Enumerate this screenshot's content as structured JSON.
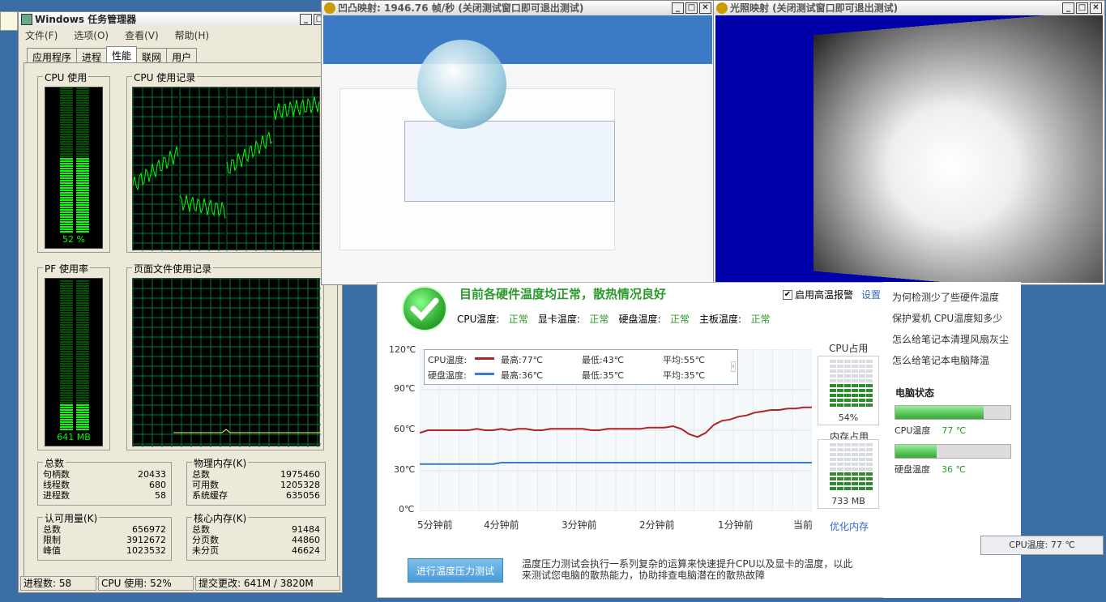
{
  "desktop": {
    "icon_label": ""
  },
  "task_manager": {
    "title": "Windows 任务管理器",
    "menu": [
      "文件(F)",
      "选项(O)",
      "查看(V)",
      "帮助(H)"
    ],
    "tabs": [
      "应用程序",
      "进程",
      "性能",
      "联网",
      "用户"
    ],
    "cpu_usage_label": "CPU 使用",
    "cpu_usage_value": "52 %",
    "cpu_history_label": "CPU 使用记录",
    "pf_label": "PF 使用率",
    "pf_value": "641 MB",
    "pf_history_label": "页面文件使用记录",
    "totals": {
      "title": "总数",
      "rows": [
        [
          "句柄数",
          "20433"
        ],
        [
          "线程数",
          "680"
        ],
        [
          "进程数",
          "58"
        ]
      ]
    },
    "physical": {
      "title": "物理内存(K)",
      "rows": [
        [
          "总数",
          "1975460"
        ],
        [
          "可用数",
          "1205328"
        ],
        [
          "系统缓存",
          "635056"
        ]
      ]
    },
    "commit": {
      "title": "认可用量(K)",
      "rows": [
        [
          "总数",
          "656972"
        ],
        [
          "限制",
          "3912672"
        ],
        [
          "峰值",
          "1023532"
        ]
      ]
    },
    "kernel": {
      "title": "核心内存(K)",
      "rows": [
        [
          "总数",
          "91484"
        ],
        [
          "分页数",
          "44860"
        ],
        [
          "未分页",
          "46624"
        ]
      ]
    },
    "status": {
      "processes": "进程数: 58",
      "cpu": "CPU 使用: 52%",
      "commit": "提交更改: 641M / 3820M"
    },
    "cpu_usage_fraction": 0.52,
    "pf_fraction": 0.17
  },
  "win_bump": {
    "title": "凹凸映射: 1946.76 帧/秒 (关闭测试窗口即可退出测试)"
  },
  "win_light": {
    "title": "光照映射 (关闭测试窗口即可退出测试)"
  },
  "luda": {
    "headline": "目前各硬件温度均正常，散热情况良好",
    "alarm_label": "启用高温报警",
    "settings_link": "设置",
    "status_items": [
      [
        "CPU温度:",
        "正常"
      ],
      [
        "显卡温度:",
        "正常"
      ],
      [
        "硬盘温度:",
        "正常"
      ],
      [
        "主板温度:",
        "正常"
      ]
    ],
    "yticks": [
      "120℃",
      "90℃",
      "60℃",
      "30℃",
      "0℃"
    ],
    "xticks": [
      "5分钟前",
      "4分钟前",
      "3分钟前",
      "2分钟前",
      "1分钟前",
      "当前"
    ],
    "legend": [
      {
        "name": "CPU温度:",
        "max": "最高:77℃",
        "min": "最低:43℃",
        "avg": "平均:55℃",
        "color": "#b22222"
      },
      {
        "name": "硬盘温度:",
        "max": "最高:36℃",
        "min": "最低:35℃",
        "avg": "平均:35℃",
        "color": "#3a7bc8"
      }
    ],
    "cpu_use_label": "CPU占用",
    "cpu_use_value": "54%",
    "mem_use_label": "内存占用",
    "mem_use_value": "733 MB",
    "optimize_link": "优化内存",
    "stress_button": "进行温度压力测试",
    "stress_desc": "温度压力测试会执行一系列复杂的运算来快速提升CPU以及显卡的温度，以此来测试您电脑的散热能力，协助排查电脑潜在的散热故障",
    "cpu_use_fraction": 0.54,
    "mem_use_fraction": 0.38
  },
  "luda_side": {
    "links": [
      "为何检测少了些硬件温度",
      "保护爱机 CPU温度知多少",
      "怎么给笔记本清理风扇灰尘",
      "怎么给笔记本电脑降温"
    ],
    "state_title": "电脑状态",
    "cpu_temp_label": "CPU温度",
    "cpu_temp_value": "77 ℃",
    "disk_temp_label": "硬盘温度",
    "disk_temp_value": "36 ℃",
    "cpu_temp_fraction": 0.77,
    "disk_temp_fraction": 0.36
  },
  "tooltip": {
    "text": "CPU温度: 77 ℃"
  },
  "chart_data": {
    "type": "line",
    "x": [
      "5分钟前",
      "4分钟前",
      "3分钟前",
      "2分钟前",
      "1分钟前",
      "当前"
    ],
    "ylim": [
      0,
      120
    ],
    "series": [
      {
        "name": "CPU温度",
        "values": [
          58,
          60,
          60,
          60,
          60,
          60,
          60,
          61,
          60,
          60,
          61,
          60,
          61,
          61,
          60,
          60,
          61,
          61,
          61,
          61,
          61,
          60,
          60,
          61,
          61,
          61,
          61,
          61,
          62,
          62,
          62,
          63,
          61,
          57,
          55,
          58,
          64,
          67,
          68,
          70,
          71,
          73,
          74,
          75,
          75,
          76,
          76,
          77,
          77
        ]
      },
      {
        "name": "硬盘温度",
        "values": [
          35,
          35,
          35,
          35,
          35,
          35,
          35,
          35,
          35,
          35,
          36,
          36,
          36,
          36,
          36,
          36,
          36,
          36,
          36,
          36,
          36,
          36,
          36,
          36,
          36,
          36,
          36,
          36,
          36,
          36,
          36,
          36,
          36,
          36,
          36,
          36,
          36,
          36,
          36,
          36,
          36,
          36,
          36,
          36,
          36,
          36,
          36,
          36,
          36
        ]
      }
    ]
  }
}
